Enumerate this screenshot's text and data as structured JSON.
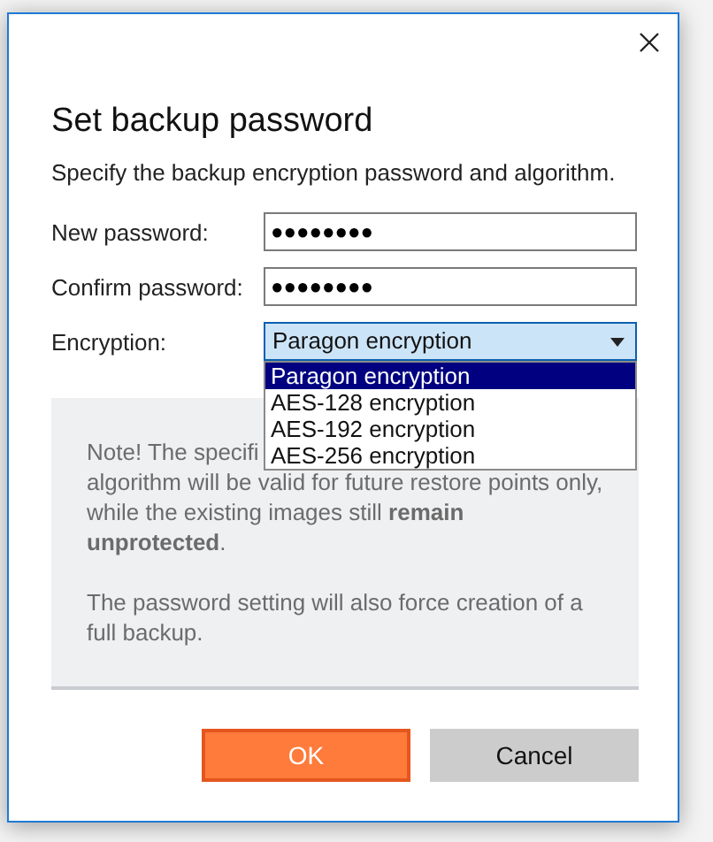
{
  "dialog": {
    "title": "Set backup password",
    "subtitle": "Specify the backup encryption password and algorithm.",
    "fields": [
      {
        "label": "New password:",
        "value": "●●●●●●●●"
      },
      {
        "label": "Confirm password:",
        "value": "●●●●●●●●"
      }
    ],
    "encryption": {
      "label": "Encryption:",
      "value": "Paragon encryption",
      "expanded": true,
      "options": [
        {
          "label": "Paragon encryption",
          "selected": true
        },
        {
          "label": "AES-128 encryption",
          "selected": false
        },
        {
          "label": "AES-192 encryption",
          "selected": false
        },
        {
          "label": "AES-256 encryption",
          "selected": false
        }
      ]
    },
    "note": {
      "first_line": "Note! The specifi",
      "paragraphs": [
        "algorithm will be valid for future restore points only, while the existing images still **remain unprotected**.",
        "The password setting will also force creation of a full backup."
      ]
    },
    "buttons": [
      {
        "label": "OK",
        "kind": "primary"
      },
      {
        "label": "Cancel",
        "kind": "secondary"
      }
    ]
  }
}
